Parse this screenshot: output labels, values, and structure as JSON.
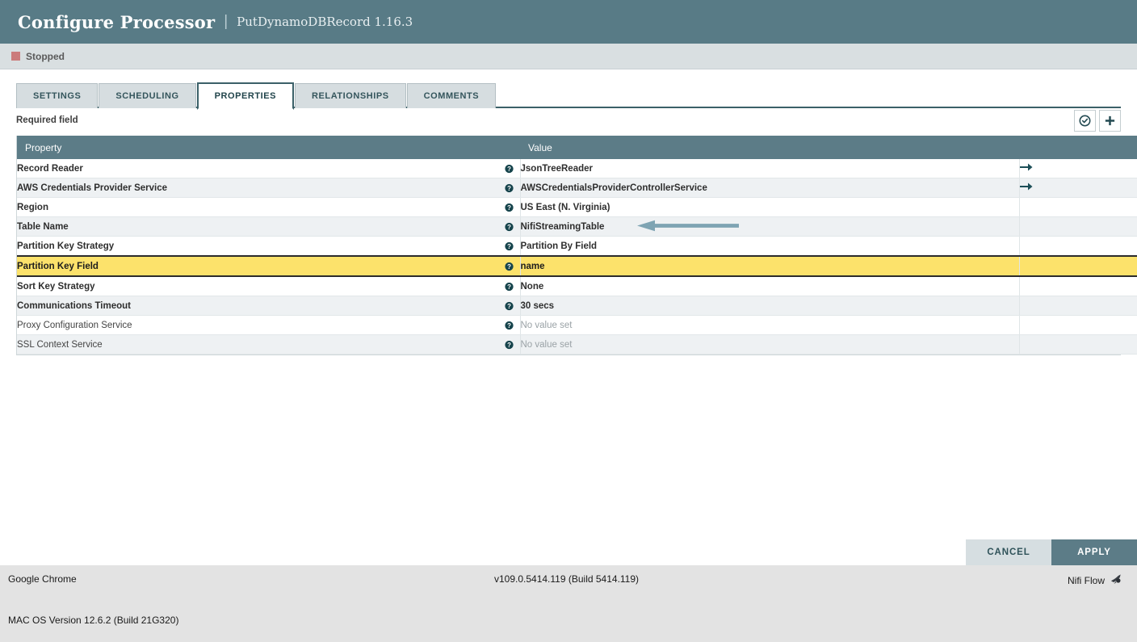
{
  "dialog": {
    "title": "Configure Processor",
    "separator": "|",
    "subtitle": "PutDynamoDBRecord 1.16.3",
    "status": "Stopped",
    "status_color": "#cb7b7b",
    "accent_color": "#587b86",
    "highlight_color": "#fce26b"
  },
  "tabs": [
    {
      "label": "SETTINGS",
      "active": false
    },
    {
      "label": "SCHEDULING",
      "active": false
    },
    {
      "label": "PROPERTIES",
      "active": true
    },
    {
      "label": "RELATIONSHIPS",
      "active": false
    },
    {
      "label": "COMMENTS",
      "active": false
    }
  ],
  "toolbar": {
    "required_field_label": "Required field",
    "verify_icon": "check-circle-icon",
    "add_icon": "plus-icon"
  },
  "table": {
    "headers": {
      "property": "Property",
      "value": "Value",
      "goto": ""
    },
    "rows": [
      {
        "property": "Record Reader",
        "value": "JsonTreeReader",
        "required": true,
        "goto": true,
        "highlighted": false
      },
      {
        "property": "AWS Credentials Provider Service",
        "value": "AWSCredentialsProviderControllerService",
        "required": true,
        "goto": true,
        "highlighted": false
      },
      {
        "property": "Region",
        "value": "US East (N. Virginia)",
        "required": true,
        "goto": false,
        "highlighted": false
      },
      {
        "property": "Table Name",
        "value": "NifiStreamingTable",
        "required": true,
        "goto": false,
        "highlighted": false,
        "annotation": "left-arrow-annotation"
      },
      {
        "property": "Partition Key Strategy",
        "value": "Partition By Field",
        "required": true,
        "goto": false,
        "highlighted": false
      },
      {
        "property": "Partition Key Field",
        "value": "name",
        "required": true,
        "goto": false,
        "highlighted": true
      },
      {
        "property": "Sort Key Strategy",
        "value": "None",
        "required": true,
        "goto": false,
        "highlighted": false
      },
      {
        "property": "Communications Timeout",
        "value": "30 secs",
        "required": true,
        "goto": false,
        "highlighted": false
      },
      {
        "property": "Proxy Configuration Service",
        "value": "No value set",
        "required": false,
        "goto": false,
        "highlighted": false
      },
      {
        "property": "SSL Context Service",
        "value": "No value set",
        "required": false,
        "goto": false,
        "highlighted": false
      }
    ]
  },
  "footer_buttons": {
    "cancel": "CANCEL",
    "apply": "APPLY"
  },
  "page_footer": {
    "browser": "Google Chrome",
    "version": "v109.0.5414.119 (Build 5414.119)",
    "os": "MAC OS Version 12.6.2 (Build 21G320)",
    "flow_label": "Nifi Flow",
    "flow_icon": "nifi-logo-icon"
  }
}
